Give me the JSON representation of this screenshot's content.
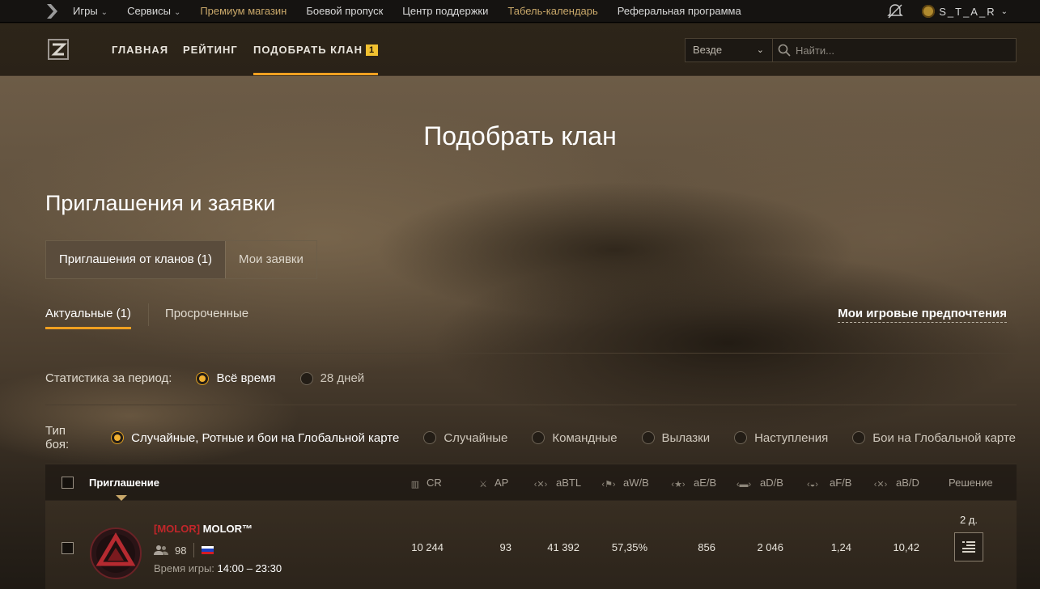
{
  "topbar": {
    "items": [
      {
        "label": "Игры",
        "has_menu": true
      },
      {
        "label": "Сервисы",
        "has_menu": true
      },
      {
        "label": "Премиум магазин",
        "highlight": true
      },
      {
        "label": "Боевой пропуск"
      },
      {
        "label": "Центр поддержки"
      },
      {
        "label": "Табель-календарь",
        "highlight": true
      },
      {
        "label": "Реферальная программа"
      }
    ],
    "username": "S_T_A_R",
    "colors": {
      "gold": "#c9a86a",
      "accent": "#f0a020"
    }
  },
  "header": {
    "tabs": [
      {
        "label": "ГЛАВНАЯ"
      },
      {
        "label": "РЕЙТИНГ"
      },
      {
        "label": "ПОДОБРАТЬ КЛАН",
        "count": "1",
        "active": true
      }
    ],
    "search": {
      "scope": "Везде",
      "placeholder": "Найти..."
    }
  },
  "page": {
    "title": "Подобрать клан",
    "section_title": "Приглашения и заявки",
    "segment": [
      "Приглашения от кланов (1)",
      "Мои заявки"
    ],
    "subtabs": [
      "Актуальные (1)",
      "Просроченные"
    ],
    "preferences_link": "Мои игровые предпочтения"
  },
  "filters": {
    "period": {
      "label": "Статистика за период:",
      "options": [
        "Всё время",
        "28 дней"
      ],
      "selected": "Всё время"
    },
    "battle_type": {
      "label": "Тип боя:",
      "options": [
        "Случайные, Ротные и бои на Глобальной карте",
        "Случайные",
        "Командные",
        "Вылазки",
        "Наступления",
        "Бои на Глобальной карте"
      ],
      "selected": "Случайные, Ротные и бои на Глобальной карте"
    }
  },
  "table": {
    "headers": {
      "invitation": "Приглашение",
      "cr": "CR",
      "ap": "AP",
      "abtl": "aBTL",
      "awb": "aW/B",
      "aeb": "aE/B",
      "adb": "aD/B",
      "afb": "aF/B",
      "abd": "aB/D",
      "decision": "Решение"
    },
    "rows": [
      {
        "tag": "[MOLOR]",
        "name": "MOLOR™",
        "members": "98",
        "time_label": "Время игры:",
        "time_value": "14:00 – 23:30",
        "cr": "10 244",
        "ap": "93",
        "abtl": "41 392",
        "awb": "57,35%",
        "aeb": "856",
        "adb": "2 046",
        "afb": "1,24",
        "abd": "10,42",
        "days": "2 д."
      }
    ]
  }
}
